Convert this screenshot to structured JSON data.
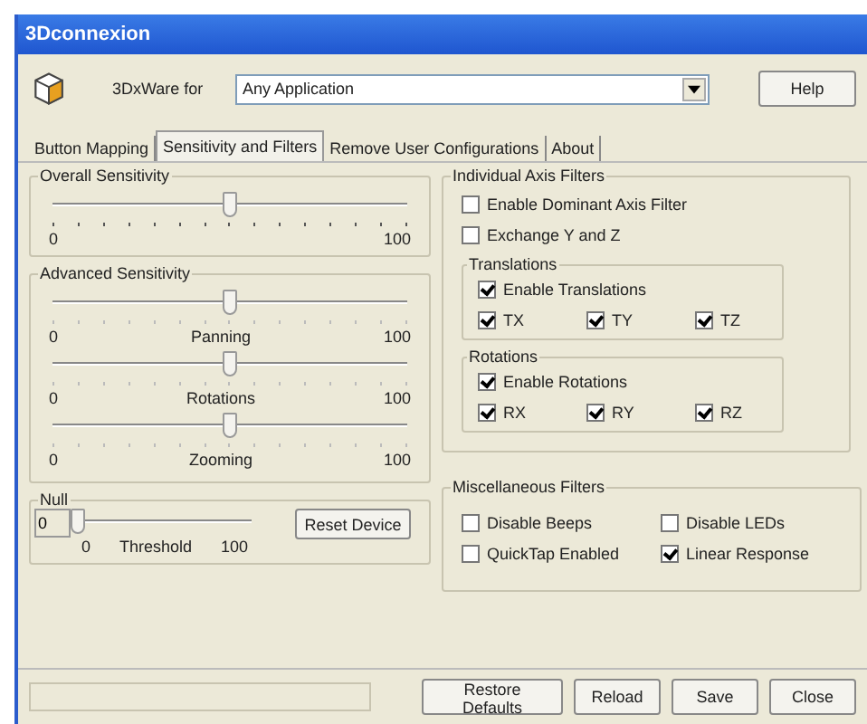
{
  "window": {
    "title": "3Dconnexion"
  },
  "header": {
    "label": "3DxWare for",
    "application": "Any Application",
    "help": "Help"
  },
  "tabs": [
    {
      "label": "Button Mapping",
      "selected": false
    },
    {
      "label": "Sensitivity and Filters",
      "selected": true
    },
    {
      "label": "Remove User Configurations",
      "selected": false
    },
    {
      "label": "About",
      "selected": false
    }
  ],
  "overall_sensitivity": {
    "title": "Overall Sensitivity",
    "slider": {
      "level": 0.5,
      "min": "0",
      "max": "100"
    }
  },
  "advanced_sensitivity": {
    "title": "Advanced Sensitivity",
    "sliders": [
      {
        "label": "Panning",
        "level": 0.5,
        "min": "0",
        "max": "100"
      },
      {
        "label": "Rotations",
        "level": 0.5,
        "min": "0",
        "max": "100"
      },
      {
        "label": "Zooming",
        "level": 0.5,
        "min": "0",
        "max": "100"
      }
    ]
  },
  "null": {
    "title": "Null",
    "value": "0",
    "slider": {
      "level": 0,
      "min": "0",
      "label": "Threshold",
      "max": "100"
    },
    "reset": "Reset Device"
  },
  "axis_filters": {
    "title": "Individual Axis Filters",
    "options": [
      {
        "label": "Enable Dominant Axis Filter",
        "checked": false
      },
      {
        "label": "Exchange Y and Z",
        "checked": false
      }
    ],
    "groups": [
      {
        "title": "Translations",
        "enable": {
          "label": "Enable Translations",
          "checked": true
        },
        "axes": [
          {
            "label": "TX",
            "checked": true
          },
          {
            "label": "TY",
            "checked": true
          },
          {
            "label": "TZ",
            "checked": true
          }
        ]
      },
      {
        "title": "Rotations",
        "enable": {
          "label": "Enable Rotations",
          "checked": true
        },
        "axes": [
          {
            "label": "RX",
            "checked": true
          },
          {
            "label": "RY",
            "checked": true
          },
          {
            "label": "RZ",
            "checked": true
          }
        ]
      }
    ]
  },
  "misc_filters": {
    "title": "Miscellaneous Filters",
    "options": [
      {
        "label": "Disable Beeps",
        "checked": false
      },
      {
        "label": "Disable LEDs",
        "checked": false
      },
      {
        "label": "QuickTap Enabled",
        "checked": false
      },
      {
        "label": "Linear Response",
        "checked": true
      }
    ]
  },
  "buttons": [
    "Restore Defaults",
    "Reload",
    "Save",
    "Close"
  ]
}
